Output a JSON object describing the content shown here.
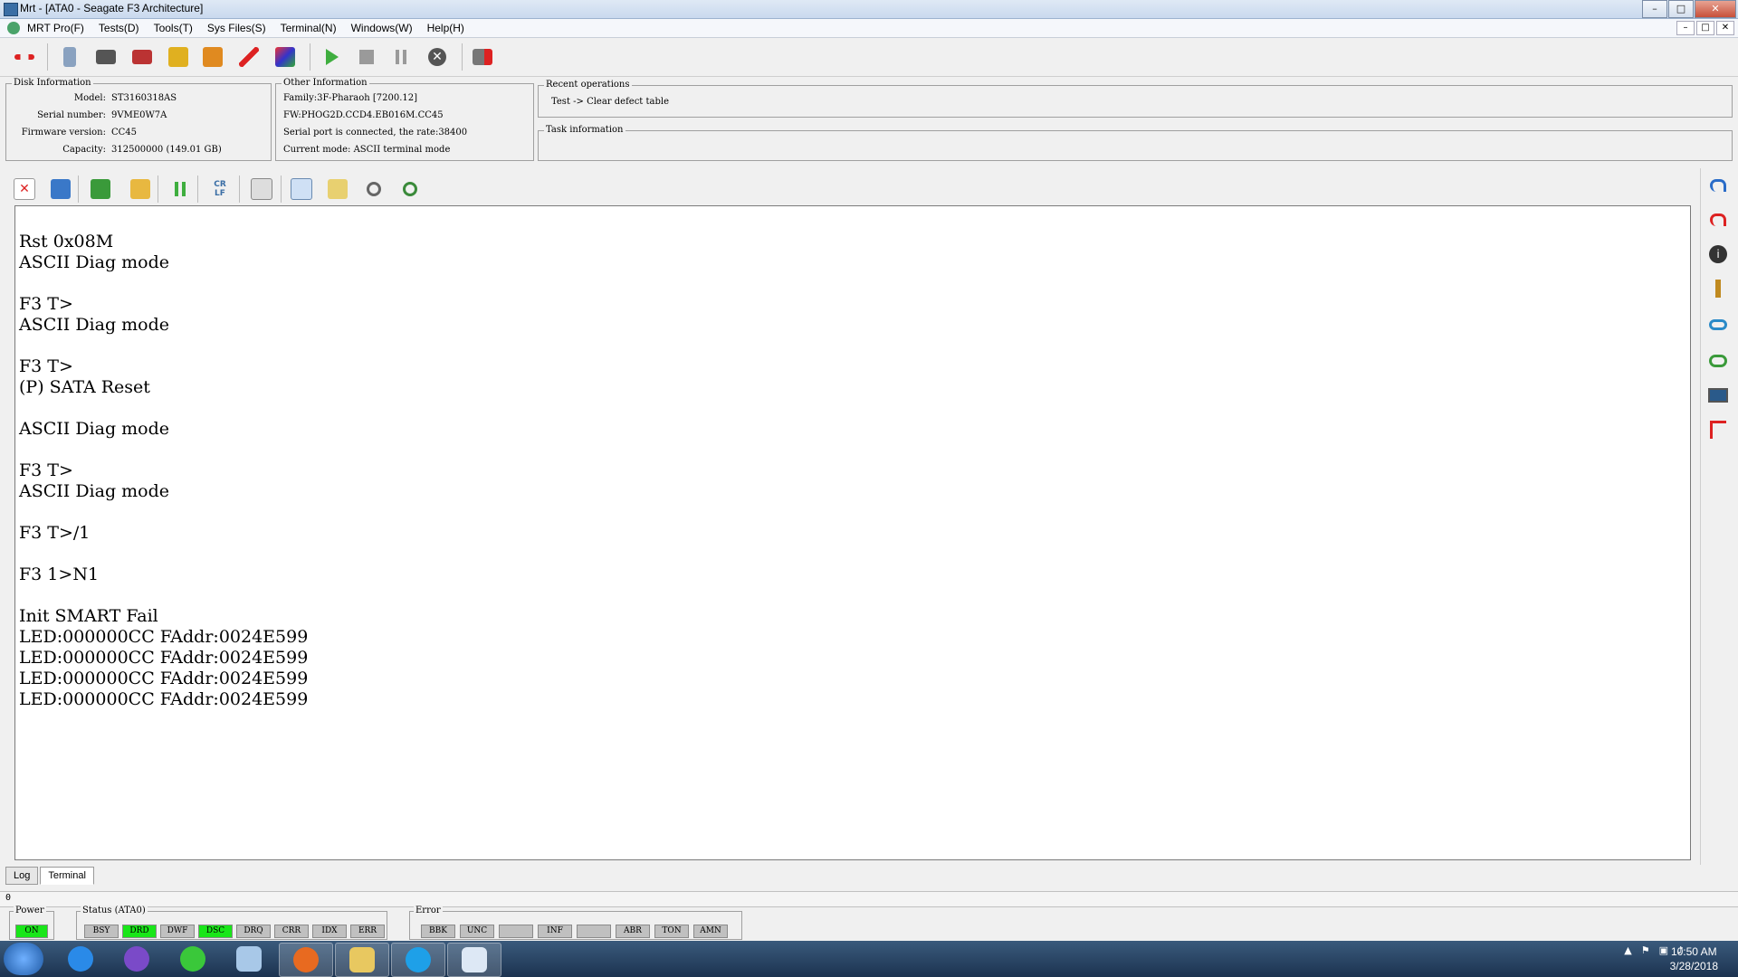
{
  "window": {
    "title": "Mrt - [ATA0 - Seagate F3 Architecture]",
    "controls": [
      "–",
      "□",
      "✕"
    ]
  },
  "menu": [
    "MRT Pro(F)",
    "Tests(D)",
    "Tools(T)",
    "Sys Files(S)",
    "Terminal(N)",
    "Windows(W)",
    "Help(H)"
  ],
  "disk_info": {
    "title": "Disk Information",
    "model_label": "Model:",
    "model": "ST3160318AS",
    "serial_label": "Serial number:",
    "serial": "9VME0W7A",
    "firmware_label": "Firmware version:",
    "firmware": "CC45",
    "capacity_label": "Capacity:",
    "capacity": "312500000 (149.01 GB)"
  },
  "other_info": {
    "title": "Other Information",
    "family": "Family:3F-Pharaoh [7200.12]",
    "fw": "FW:PHOG2D.CCD4.EB016M.CC45",
    "serial_port": "Serial port is connected, the rate:38400",
    "mode": "Current mode: ASCII terminal mode"
  },
  "recent_ops": {
    "title": "Recent operations",
    "text": "Test -> Clear defect table"
  },
  "task_info": {
    "title": "Task information"
  },
  "terminal_lines": [
    "Rst 0x08M",
    "ASCII Diag mode",
    "",
    "F3 T>",
    "ASCII Diag mode",
    "",
    "F3 T>",
    "(P) SATA Reset",
    "",
    "ASCII Diag mode",
    "",
    "F3 T>",
    "ASCII Diag mode",
    "",
    "F3 T>/1",
    "",
    "F3 1>N1",
    "",
    "Init SMART Fail",
    "LED:000000CC FAddr:0024E599",
    "LED:000000CC FAddr:0024E599",
    "LED:000000CC FAddr:0024E599",
    "LED:000000CC FAddr:0024E599"
  ],
  "tabs": [
    "Log",
    "Terminal"
  ],
  "status_value": "0",
  "power": {
    "title": "Power",
    "label": "ON"
  },
  "status": {
    "title": "Status (ATA0)",
    "flags": [
      {
        "label": "BSY",
        "on": false
      },
      {
        "label": "DRD",
        "on": true
      },
      {
        "label": "DWF",
        "on": false
      },
      {
        "label": "DSC",
        "on": true
      },
      {
        "label": "DRQ",
        "on": false
      },
      {
        "label": "CRR",
        "on": false
      },
      {
        "label": "IDX",
        "on": false
      },
      {
        "label": "ERR",
        "on": false
      }
    ]
  },
  "error": {
    "title": "Error",
    "flags": [
      {
        "label": "BBK"
      },
      {
        "label": "UNC"
      },
      {
        "label": ""
      },
      {
        "label": "INF"
      },
      {
        "label": ""
      },
      {
        "label": "ABR"
      },
      {
        "label": "TON"
      },
      {
        "label": "AMN"
      }
    ]
  },
  "clock": {
    "time": "10:50 AM",
    "date": "3/28/2018"
  },
  "colors": {
    "flag_on": "#19e619",
    "flag_off": "#c0c0c0",
    "taskbar": "#1c3350"
  }
}
